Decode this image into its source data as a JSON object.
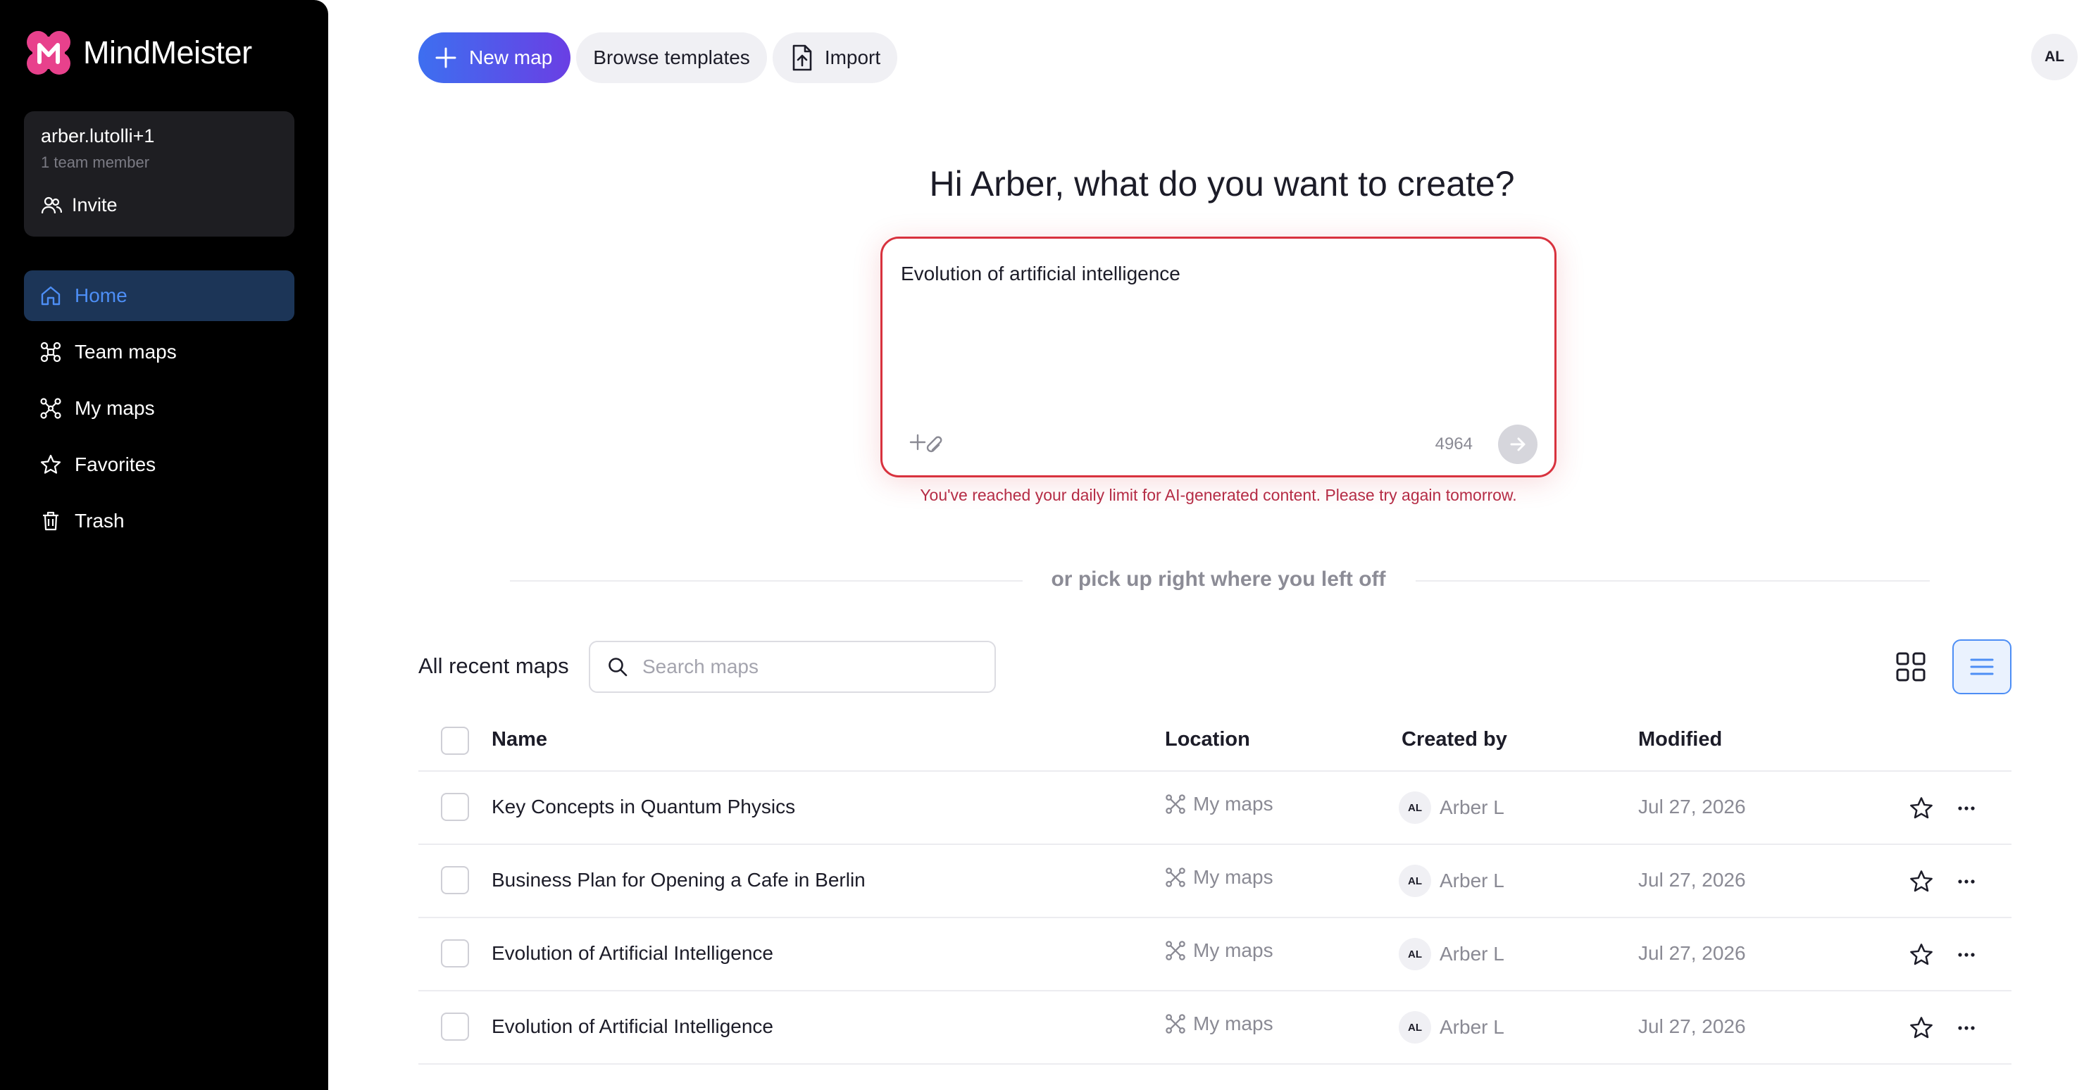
{
  "brand": {
    "name": "MindMeister",
    "logo_letter": "M",
    "colors": {
      "logo": "#e8418c",
      "accent": "#4d8ef5",
      "new_map_gradient": [
        "#3d6ff0",
        "#6a3fe4"
      ],
      "error": "#d8323e"
    }
  },
  "sidebar": {
    "team": {
      "name": "arber.lutolli+1",
      "members": "1 team member",
      "invite_label": "Invite"
    },
    "items": [
      {
        "label": "Home",
        "icon": "home-icon",
        "active": true
      },
      {
        "label": "Team maps",
        "icon": "team-maps-icon",
        "active": false
      },
      {
        "label": "My maps",
        "icon": "my-maps-icon",
        "active": false
      },
      {
        "label": "Favorites",
        "icon": "star-icon",
        "active": false
      },
      {
        "label": "Trash",
        "icon": "trash-icon",
        "active": false
      }
    ]
  },
  "toolbar": {
    "new_map": "New map",
    "browse_templates": "Browse templates",
    "import": "Import"
  },
  "user": {
    "initials": "AL"
  },
  "hero": {
    "title": "Hi Arber, what do you want to create?",
    "prompt_value": "Evolution of artificial intelligence",
    "char_count": "4964",
    "limit_message": "You've reached your daily limit for AI-generated content. Please try again tomorrow."
  },
  "divider_text": "or pick up right where you left off",
  "recent": {
    "title": "All recent maps",
    "search_placeholder": "Search maps",
    "view_mode": "list",
    "columns": {
      "name": "Name",
      "location": "Location",
      "created_by": "Created by",
      "modified": "Modified"
    },
    "rows": [
      {
        "name": "Key Concepts in Quantum Physics",
        "location": "My maps",
        "creator_initials": "AL",
        "creator": "Arber L",
        "modified": "Jul 27, 2026"
      },
      {
        "name": "Business Plan for Opening a Cafe in Berlin",
        "location": "My maps",
        "creator_initials": "AL",
        "creator": "Arber L",
        "modified": "Jul 27, 2026"
      },
      {
        "name": "Evolution of Artificial Intelligence",
        "location": "My maps",
        "creator_initials": "AL",
        "creator": "Arber L",
        "modified": "Jul 27, 2026"
      },
      {
        "name": "Evolution of Artificial Intelligence",
        "location": "My maps",
        "creator_initials": "AL",
        "creator": "Arber L",
        "modified": "Jul 27, 2026"
      }
    ]
  }
}
